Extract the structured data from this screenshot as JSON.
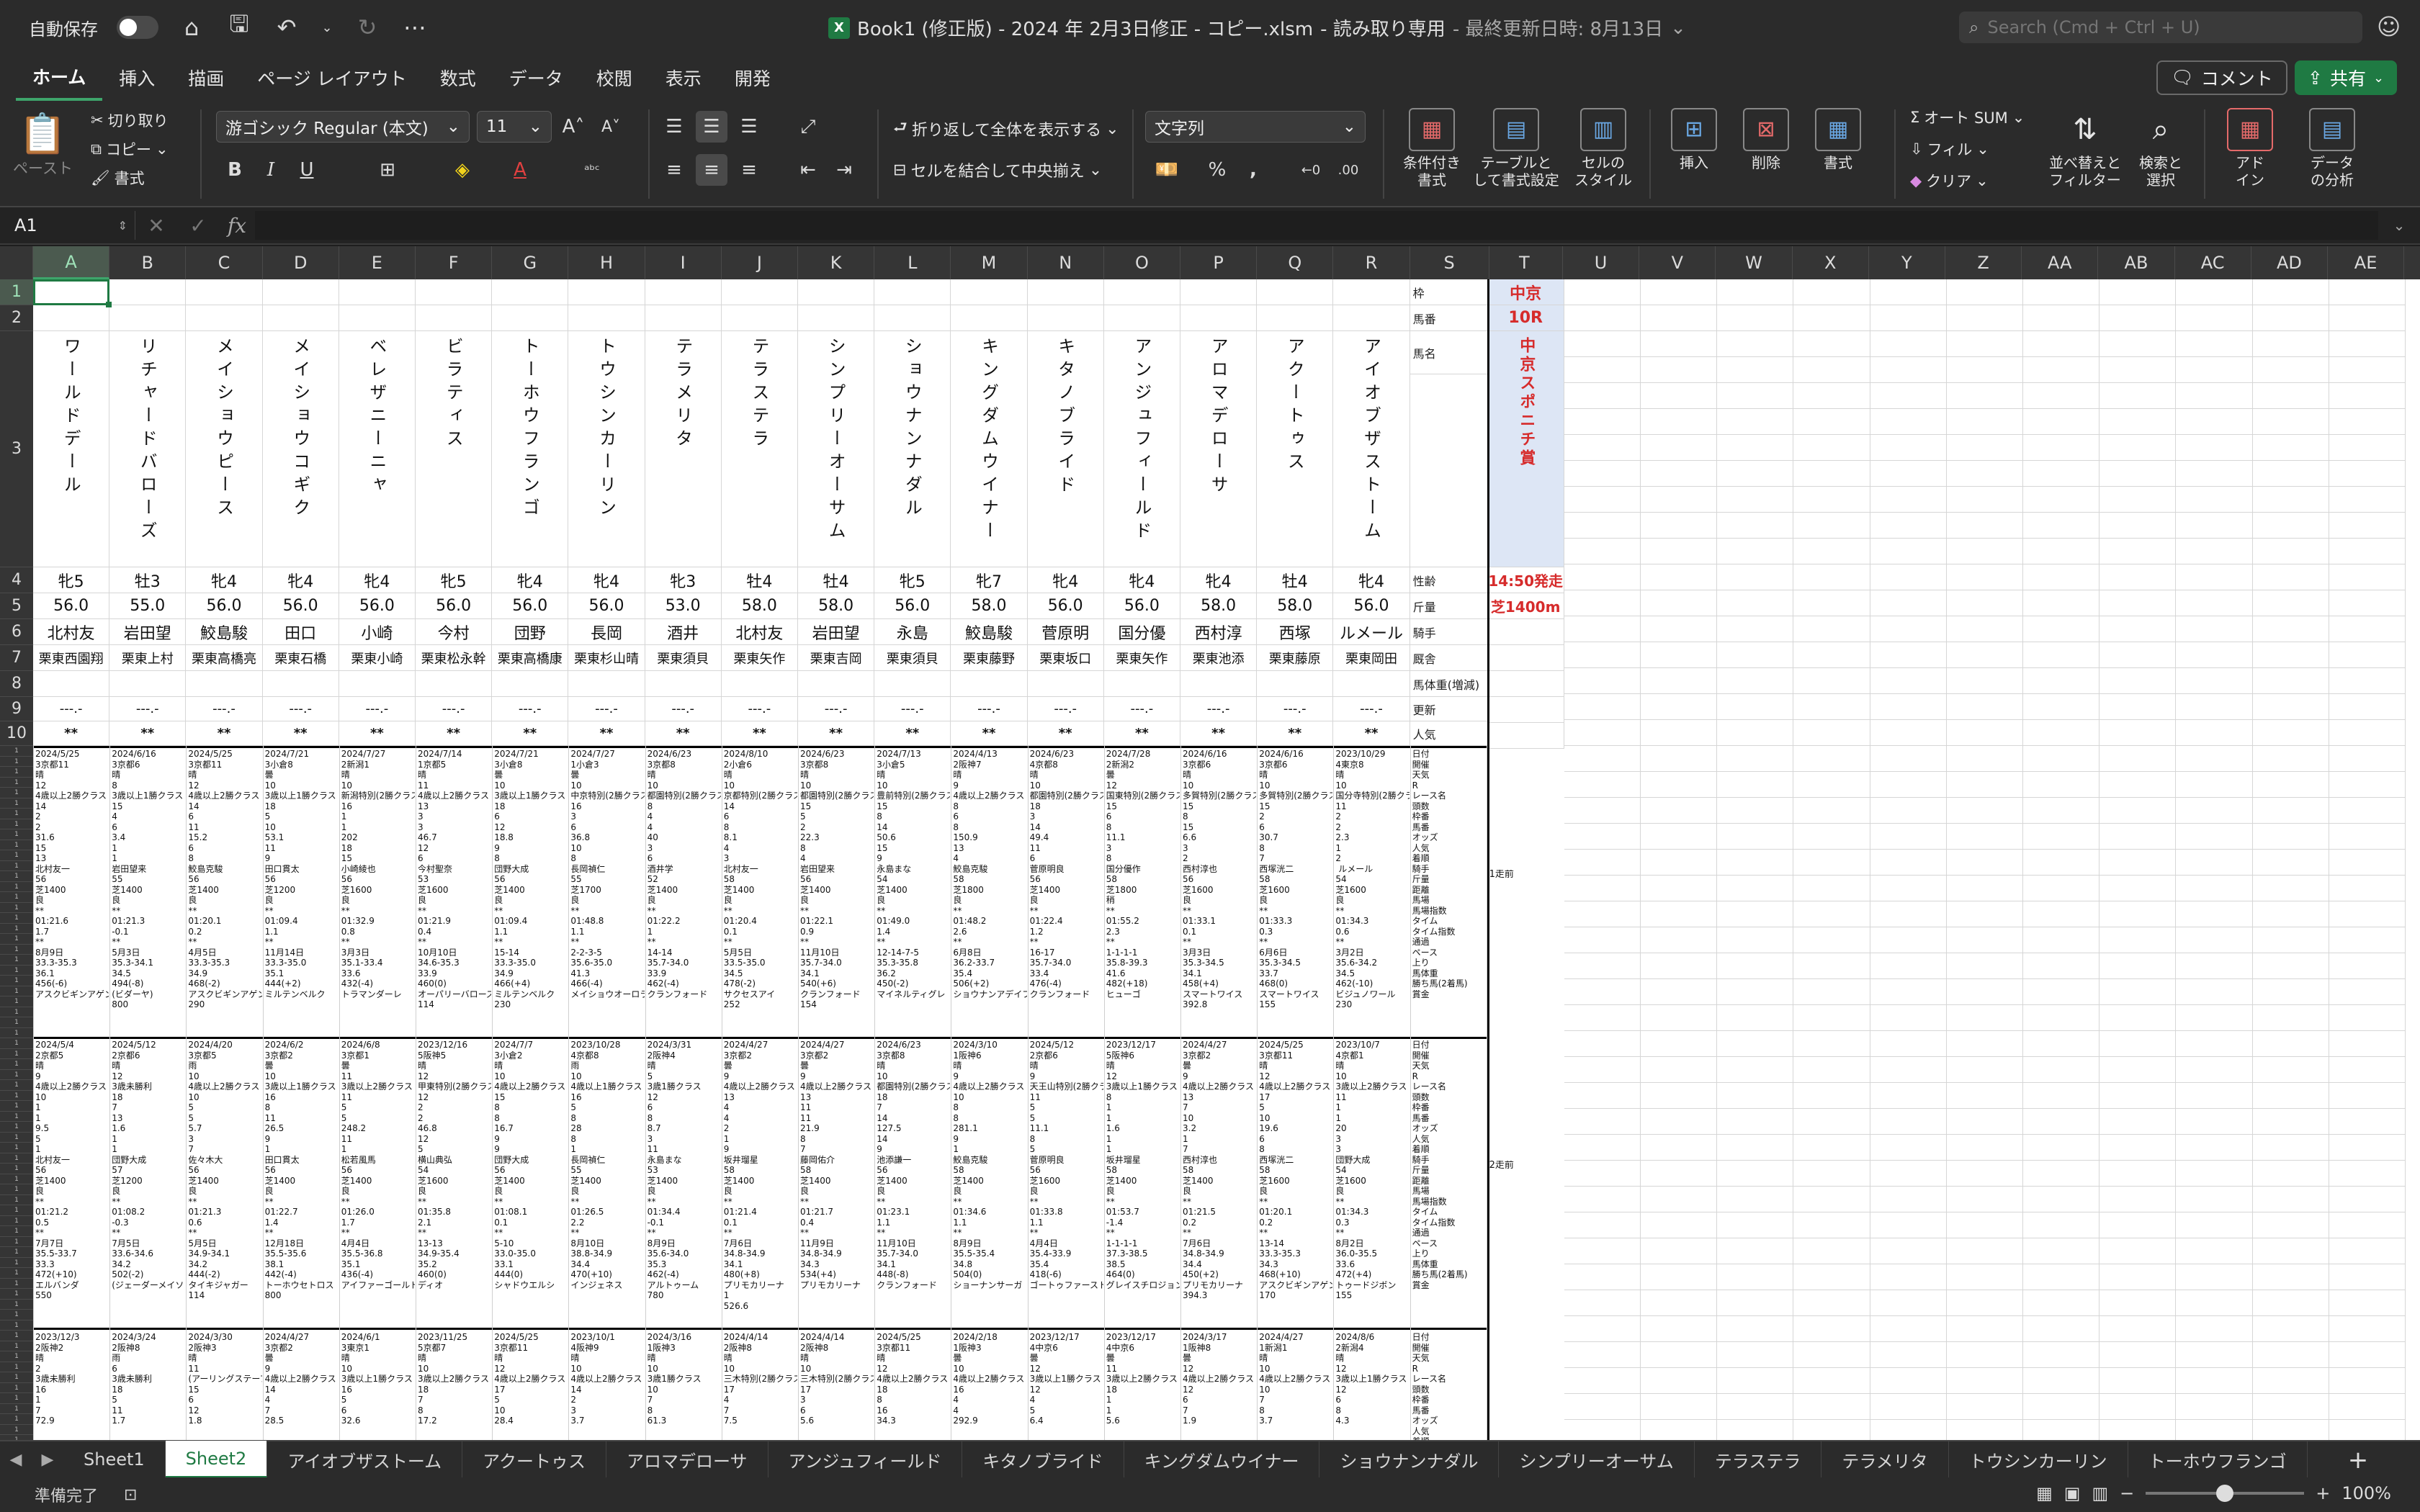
{
  "titlebar": {
    "autosave_label": "自動保存",
    "title": "Book1 (修正版) - 2024 年 2月3日修正 - コピー.xlsm",
    "readonly": "-  読み取り専用",
    "last_modified": "- 最終更新日時: 8月13日",
    "search_placeholder": "Search (Cmd + Ctrl + U)"
  },
  "ribbon_tabs": [
    "ホーム",
    "挿入",
    "描画",
    "ページ レイアウト",
    "数式",
    "データ",
    "校閲",
    "表示",
    "開発"
  ],
  "ribbon_buttons": {
    "comment": "コメント",
    "share": "共有",
    "paste": "ペースト",
    "cut": "切り取り",
    "copy": "コピー",
    "format_painter": "書式",
    "font_name": "游ゴシック Regular (本文)",
    "font_size": "11",
    "wrap_text": "折り返して全体を表示する",
    "merge_center": "セルを結合して中央揃え",
    "number_format": "文字列",
    "conditional_format": "条件付き\n書式",
    "format_as_table": "テーブルと\nして書式設定",
    "cell_styles": "セルの\nスタイル",
    "insert": "挿入",
    "delete": "削除",
    "format": "書式",
    "autosum": "オート SUM",
    "fill": "フィル",
    "clear": "クリア",
    "sort_filter": "並べ替えと\nフィルター",
    "find_select": "検索と\n選択",
    "addins": "アド\nイン",
    "analyze": "データ\nの分析"
  },
  "formula_bar": {
    "name_box": "A1",
    "formula": ""
  },
  "columns": [
    "A",
    "B",
    "C",
    "D",
    "E",
    "F",
    "G",
    "H",
    "I",
    "J",
    "K",
    "L",
    "M",
    "N",
    "O",
    "P",
    "Q",
    "R",
    "S",
    "T",
    "U",
    "V",
    "W",
    "X",
    "Y",
    "Z",
    "AA",
    "AB",
    "AC",
    "AD",
    "AE"
  ],
  "rows_visible": [
    "1",
    "2",
    "3",
    "4",
    "5",
    "6",
    "7",
    "8",
    "9",
    "10"
  ],
  "sheet": {
    "horse_names": [
      "ワールドデール",
      "リチャードバローズ",
      "メイショウピース",
      "メイショウコギク",
      "ベレザニーニャ",
      "ビラティス",
      "トーホウフランゴ",
      "トウシンカーリン",
      "テラメリタ",
      "テラステラ",
      "シンプリーオーサム",
      "ショウナンナダル",
      "キングダムウイナー",
      "キタノブライド",
      "アンジュフィールド",
      "アロマデローサ",
      "アクートゥス",
      "アイオブザストーム"
    ],
    "sex_age": [
      "牝5",
      "牡3",
      "牝4",
      "牝4",
      "牝4",
      "牝5",
      "牝4",
      "牝4",
      "牝3",
      "牡4",
      "牡4",
      "牝5",
      "牝7",
      "牝4",
      "牝4",
      "牝4",
      "牡4",
      "牝4"
    ],
    "weight": [
      "56.0",
      "55.0",
      "56.0",
      "56.0",
      "56.0",
      "56.0",
      "56.0",
      "56.0",
      "53.0",
      "58.0",
      "58.0",
      "56.0",
      "58.0",
      "56.0",
      "56.0",
      "58.0",
      "58.0",
      "56.0"
    ],
    "jockey": [
      "北村友",
      "岩田望",
      "鮫島駿",
      "田口",
      "小崎",
      "今村",
      "団野",
      "長岡",
      "酒井",
      "北村友",
      "岩田望",
      "永島",
      "鮫島駿",
      "菅原明",
      "国分優",
      "西村淳",
      "西塚",
      "ルメール"
    ],
    "stable": [
      "栗東西園翔",
      "栗東上村",
      "栗東高橋亮",
      "栗東石橋",
      "栗東小崎",
      "栗東松永幹",
      "栗東高橋康",
      "栗東杉山晴",
      "栗東須貝",
      "栗東矢作",
      "栗東吉岡",
      "栗東須貝",
      "栗東藤野",
      "栗東坂口",
      "栗東矢作",
      "栗東池添",
      "栗東藤原",
      "栗東岡田"
    ],
    "odds_placeholder": "---.-",
    "popularity_placeholder": "**",
    "labels": [
      "枠",
      "馬番",
      "馬名",
      "性齢",
      "斤量",
      "騎手",
      "厩舎",
      "馬体重(増減)",
      "更新",
      "人気"
    ],
    "race": {
      "venue": "中京",
      "race_no": "10R",
      "name": "中京スポニチ賞",
      "post_time": "14:50発走",
      "course": "芝1400m"
    },
    "past_labels": "日付\n開催\n天気\nR\nレース名\n頭数\n枠番\n馬番\nオッズ\n人気\n着順\n騎手\n斤量\n距離\n馬場\n馬場指数\nタイム\nタイム指数\n通過\nペース\n上り\n馬体重\n勝ち馬(2着馬)\n賞金",
    "past_run_1": "1走前",
    "past_run_2": "2走前",
    "past1": [
      "2024/5/25\n3京都11\n晴\n12\n4歳以上2勝クラス\n14\n2\n2\n31.6\n15\n13\n北村友一\n56\n芝1400\n良\n**\n01:21.6\n1.7\n**\n8月9日\n33.3-35.3\n36.1\n456(-6)\nアスクビギンアゲン",
      "2024/6/16\n3京都6\n晴\n8\n3歳以上1勝クラス\n15\n4\n6\n3.4\n1\n1\n岩田望来\n55\n芝1400\n良\n**\n01:21.3\n-0.1\n**\n5月3日\n35.3-34.1\n34.5\n494(-8)\n(ビダーヤ)\n800",
      "2024/5/25\n3京都11\n晴\n12\n4歳以上2勝クラス\n14\n6\n11\n15.2\n6\n8\n鮫島克駿\n56\n芝1400\n良\n**\n01:20.1\n0.2\n**\n4月5日\n33.3-35.3\n34.9\n468(-2)\nアスクビギンアゲン\n290",
      "2024/7/21\n3小倉8\n曇\n10\n3歳以上1勝クラス\n18\n5\n10\n53.1\n11\n9\n田口貫太\n56\n芝1200\n良\n**\n01:09.4\n1.1\n**\n11月14日\n33.3-35.0\n35.1\n444(+2)\nミルテンベルク",
      "2024/7/27\n2新潟1\n晴\n10\n新潟特別(2勝クラス)\n16\n1\n1\n202\n18\n15\n小崎綾也\n56\n芝1600\n良\n**\n01:32.9\n0.8\n**\n3月3日\n35.1-33.4\n33.6\n432(-4)\nトラマンダーレ",
      "2024/7/14\n1京都5\n晴\n11\n4歳以上2勝クラス\n13\n3\n3\n46.7\n12\n6\n今村聖奈\n53\n芝1600\n良\n**\n01:21.9\n0.4\n**\n10月10日\n34.6-35.3\n33.9\n460(0)\nオーパリーバローズ\n114",
      "2024/7/21\n3小倉8\n曇\n10\n3歳以上1勝クラス\n18\n6\n12\n18.8\n9\n8\n団野大成\n56\n芝1400\n良\n**\n01:09.4\n1.1\n**\n15-14\n33.3-35.0\n34.9\n466(+4)\nミルテンベルク\n230",
      "2024/7/27\n1小倉3\n曇\n10\n中京特別(2勝クラス)\n16\n3\n6\n36.8\n10\n8\n長岡禎仁\n55\n芝1700\n良\n**\n01:48.8\n1.1\n**\n2-2-3-5\n35.6-35.0\n41.3\n466(-4)\nメイショウオーロラ",
      "2024/6/23\n3京都8\n晴\n10\n都園特別(2勝クラス)\n8\n4\n4\n40\n3\n6\n酒井学\n52\n芝1400\n良\n**\n01:22.2\n1\n**\n14-14\n35.7-34.0\n33.9\n462(-4)\nクランフォード",
      "2024/8/10\n2小倉6\n晴\n10\n京都特別(2勝クラス)\n14\n6\n8\n8.1\n4\n3\n北村友一\n58\n芝1400\n良\n**\n01:20.4\n0.1\n**\n5月5日\n33.5-35.0\n34.5\n478(-2)\nサクセスアイ\n252",
      "2024/6/23\n3京都8\n晴\n10\n都園特別(2勝クラス)\n15\n5\n2\n22.3\n8\n4\n岩田望来\n56\n芝1400\n良\n**\n01:22.1\n0.9\n**\n11月10日\n35.7-34.0\n34.1\n540(+6)\nクランフォード\n154",
      "2024/7/13\n3小倉5\n晴\n10\n豊前特別(2勝クラス)\n15\n8\n14\n50.6\n15\n9\n永島まな\n54\n芝1400\n良\n**\n01:49.0\n1.4\n**\n12-14-7-5\n35.3-35.8\n36.2\n450(-2)\nマイネルティグレ",
      "2024/4/13\n2阪神7\n晴\n9\n4歳以上2勝クラス\n8\n6\n8\n150.9\n13\n4\n鮫島克駿\n58\n芝1800\n良\n**\n01:48.2\n2.6\n**\n6月8日\n36.2-33.7\n35.4\n506(+2)\nショウナンアデイブ",
      "2024/6/23\n4京都8\n晴\n10\n都園特別(2勝クラス)\n18\n3\n14\n49.4\n11\n6\n菅原明良\n56\n芝1400\n良\n**\n01:22.4\n1.2\n**\n16-17\n35.7-34.0\n33.4\n476(-4)\nクランフォード",
      "2024/7/28\n2新潟2\n曇\n12\n国東特別(2勝クラス)\n15\n6\n8\n11.1\n3\n8\n国分優作\n58\n芝1800\n稍\n**\n01:55.2\n2.3\n**\n1-1-1-1\n35.8-39.3\n41.6\n482(+18)\nヒューゴ",
      "2024/6/16\n3京都6\n晴\n10\n多賀特別(2勝クラス)\n15\n8\n15\n6.6\n3\n2\n西村淳也\n56\n芝1600\n良\n**\n01:33.1\n0.1\n**\n3月3日\n35.3-34.5\n34.1\n458(+4)\nスマートワイス\n392.8",
      "2024/6/16\n3京都6\n晴\n10\n多賀特別(2勝クラス)\n15\n2\n6\n30.7\n8\n7\n西塚洸二\n58\n芝1600\n良\n**\n01:33.3\n0.3\n**\n6月6日\n35.3-34.5\n33.7\n468(0)\nスマートワイス\n155",
      "2023/10/29\n4東京8\n晴\n10\n国分寺特別(2勝クラス)\n11\n2\n2\n2.3\n1\n2\n ルメール\n54\n芝1600\n良\n**\n01:34.3\n0.6\n**\n3月2日\n35.6-34.2\n34.5\n462(-10)\nビジュノワール\n230"
    ],
    "past2": [
      "2024/5/4\n2京都5\n晴\n9\n4歳以上2勝クラス\n10\n1\n1\n9.5\n5\n1\n北村友一\n56\n芝1400\n良\n**\n01:21.2\n0.5\n**\n7月7日\n35.5-33.7\n33.3\n472(+10)\nエルバンダ\n550",
      "2024/5/12\n2京都6\n晴\n12\n3歳未勝利\n18\n7\n13\n1.6\n1\n1\n団野大成\n57\n芝1200\n良\n**\n01:08.2\n-0.3\n**\n7月5日\n33.6-34.6\n34.2\n502(-2)\n(ジェーダーメイソン)",
      "2024/4/20\n3京都5\n雨\n10\n4歳以上2勝クラス\n10\n5\n5\n5.7\n3\n7\n佐々木大\n56\n芝1400\n良\n**\n01:21.3\n0.6\n**\n5月5日\n34.9-34.1\n34.2\n444(-2)\nタイキジャガー\n114",
      "2024/6/2\n3京都2\n曇\n10\n3歳以上1勝クラス\n16\n8\n11\n26.5\n9\n1\n田口貫太\n56\n芝1400\n良\n**\n01:22.7\n1.4\n**\n12月18日\n35.5-35.6\n38.1\n442(-4)\nトーホウセトロス\n800",
      "2024/6/8\n3京都1\n曇\n11\n3歳以上2勝クラス\n11\n5\n5\n248.2\n11\n1\n松若風馬\n56\n芝1400\n良\n**\n01:26.0\n1.7\n**\n4月4日\n35.5-36.8\n35.1\n436(-4)\nアイファーゴールド",
      "2023/12/16\n5阪神5\n晴\n12\n甲東特別(2勝クラス)\n12\n2\n2\n46.8\n12\n5\n横山典弘\n54\n芝1600\n良\n**\n01:35.8\n2.1\n**\n13-13\n34.9-35.4\n35.2\n460(0)\nディオ",
      "2024/7/7\n3小倉2\n晴\n10\n4歳以上2勝クラス\n15\n8\n8\n16.7\n9\n9\n団野大成\n56\n芝1400\n良\n**\n01:08.1\n0.1\n**\n5-10\n33.0-35.0\n33.1\n444(0)\nシャドウエルシ",
      "2023/10/28\n4京都8\n雨\n10\n4歳以上1勝クラス\n16\n5\n8\n28\n8\n1\n長岡禎仁\n55\n芝1400\n良\n**\n01:26.5\n2.2\n**\n8月10日\n38.8-34.9\n34.4\n470(+10)\nインジェネス",
      "2024/3/31\n2阪神4\n晴\n5\n3歳1勝クラス\n12\n6\n8\n8.7\n3\n11\n永島まな\n53\n芝1400\n良\n**\n01:34.4\n-0.1\n**\n8月9日\n35.6-34.0\n35.3\n462(-4)\nアルトゥーム\n780",
      "2024/4/27\n3京都2\n曇\n9\n4歳以上2勝クラス\n13\n4\n4\n2\n1\n9\n坂井瑠星\n58\n芝1400\n良\n**\n01:21.4\n0.1\n**\n7月6日\n34.8-34.9\n34.1\n480(+8)\nプリモカリーナ\n1\n526.6",
      "2024/4/27\n3京都2\n曇\n9\n4歳以上2勝クラス\n13\n11\n11\n21.9\n8\n7\n藤岡佑介\n58\n芝1400\n良\n**\n01:21.7\n0.4\n**\n11月9日\n34.8-34.9\n34.3\n534(+4)\nプリモカリーナ",
      "2024/6/23\n3京都8\n晴\n10\n都園特別(2勝クラス)\n18\n7\n14\n127.5\n14\n9\n池添謙一\n56\n芝1400\n良\n**\n01:23.1\n1.1\n**\n11月10日\n35.7-34.0\n34.1\n448(-8)\nクランフォード",
      "2024/3/10\n1阪神6\n晴\n9\n4歳以上2勝クラス\n10\n8\n8\n281.1\n9\n1\n鮫島克駿\n58\n芝1400\n良\n**\n01:34.6\n1.1\n**\n8月9日\n35.5-35.4\n34.8\n504(0)\nショーナンサーガ",
      "2024/5/12\n2京都6\n晴\n9\n天王山特別(2勝クラス)\n11\n5\n5\n11.1\n8\n5\n菅原明良\n56\n芝1600\n良\n**\n01:33.8\n1.1\n**\n4月4日\n35.4-33.9\n35.4\n418(-6)\nゴートゥファースト",
      "2023/12/17\n5阪神6\n晴\n12\n3歳以上1勝クラス\n8\n1\n1\n1.6\n1\n1\n坂井瑠星\n58\n芝1400\n良\n**\n01:53.7\n-1.4\n**\n1-1-1-1\n37.3-38.5\n38.5\n464(0)\nグレイスチロジョン",
      "2024/4/27\n3京都2\n曇\n9\n4歳以上2勝クラス\n13\n7\n10\n3.2\n1\n7\n西村淳也\n58\n芝1400\n良\n**\n01:21.5\n0.2\n**\n7月6日\n34.8-34.9\n34.4\n450(+2)\nプリモカリーナ\n394.3",
      "2024/5/25\n3京都11\n晴\n12\n4歳以上2勝クラス\n17\n5\n10\n19.6\n6\n8\n西塚洸二\n58\n芝1600\n良\n**\n01:20.1\n0.2\n**\n13-14\n33.3-35.3\n34.3\n468(+10)\nアスクビギンアゲン\n170",
      "2023/10/7\n4京都1\n晴\n10\n3歳以上2勝クラス\n11\n1\n1\n20\n3\n3\n団野大成\n54\n芝1600\n良\n**\n01:34.3\n0.3\n**\n8月2日\n36.0-35.5\n33.6\n472(+4)\nトゥードジボン\n155"
    ],
    "past3_header": [
      "2023/12/3\n2阪神2\n晴\n2\n3歳未勝利\n16\n1\n7\n72.9",
      "2024/3/24\n2阪神8\n雨\n6\n3歳未勝利\n18\n5\n11\n1.7",
      "2024/3/30\n2阪神3\n晴\n11\n(アーリングステーブル)\n15\n6\n12\n1.8",
      "2024/4/27\n3京都2\n曇\n9\n4歳以上2勝クラス\n14\n4\n7\n28.5",
      "2024/6/1\n3東京1\n晴\n10\n3歳以上1勝クラス\n16\n5\n6\n32.6",
      "2023/11/25\n5京都7\n晴\n10\n3歳以上2勝クラス\n18\n7\n8\n17.2",
      "2024/5/25\n3京都11\n晴\n12\n4歳以上2勝クラス\n17\n5\n10\n28.4",
      "2023/10/1\n4阪神9\n晴\n10\n4歳以上2勝クラス\n14\n2\n3\n3.7",
      "2024/3/16\n1阪神3\n晴\n10\n3歳1勝クラス\n10\n7\n8\n61.3",
      "2024/4/14\n2阪神8\n晴\n10\n三木特別(2勝クラス)\n17\n4\n7\n7.5",
      "2024/4/14\n2阪神8\n晴\n10\n三木特別(2勝クラス)\n17\n3\n6\n5.6",
      "2024/5/25\n3京都11\n晴\n12\n4歳以上2勝クラス\n18\n8\n16\n34.3",
      "2024/2/18\n1阪神3\n曇\n10\n4歳以上2勝クラス\n16\n4\n4\n292.9",
      "2023/12/17\n4中京6\n曇\n12\n3歳以上1勝クラス\n12\n4\n5\n6.4",
      "2023/12/17\n4中京6\n曇\n11\n3歳以上2勝クラス\n18\n1\n1\n5.6",
      "2024/3/17\n1阪神8\n曇\n12\n4歳以上2勝クラス\n12\n6\n7\n1.9",
      "2024/4/27\n1新潟1\n晴\n10\n4歳以上2勝クラス\n10\n7\n8\n3.7",
      "2024/8/6\n2新潟4\n晴\n12\n3歳以上1勝クラス\n12\n6\n8\n4.3"
    ]
  },
  "sheet_tabs": [
    "Sheet1",
    "Sheet2",
    "アイオブザストーム",
    "アクートゥス",
    "アロマデローサ",
    "アンジュフィールド",
    "キタノブライド",
    "キングダムウイナー",
    "ショウナンナダル",
    "シンプリーオーサム",
    "テラステラ",
    "テラメリタ",
    "トウシンカーリン",
    "トーホウフランゴ"
  ],
  "active_sheet": "Sheet2",
  "status": {
    "ready": "準備完了",
    "zoom": "100%",
    "zoom_level": 0.5
  }
}
